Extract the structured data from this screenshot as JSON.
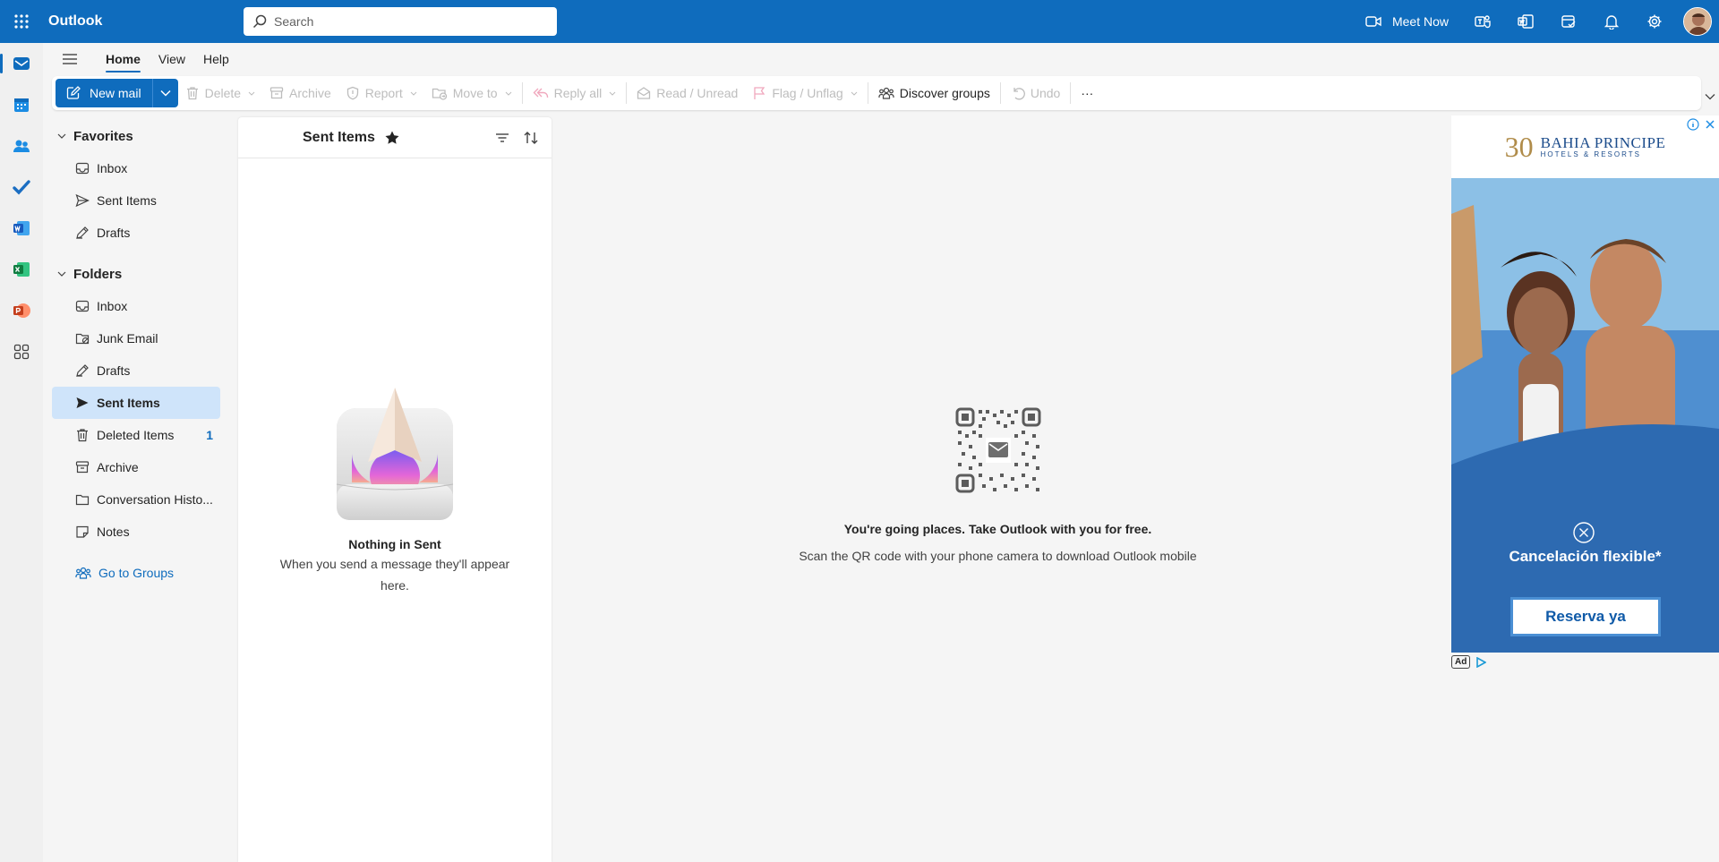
{
  "app": {
    "title": "Outlook"
  },
  "search": {
    "placeholder": "Search"
  },
  "topbar": {
    "meet_now": "Meet Now"
  },
  "tabs": [
    {
      "label": "Home",
      "active": true
    },
    {
      "label": "View",
      "active": false
    },
    {
      "label": "Help",
      "active": false
    }
  ],
  "ribbon": {
    "new_mail": "New mail",
    "delete": "Delete",
    "archive": "Archive",
    "report": "Report",
    "move_to": "Move to",
    "reply_all": "Reply all",
    "read_unread": "Read / Unread",
    "flag_unflag": "Flag / Unflag",
    "discover_groups": "Discover groups",
    "undo": "Undo",
    "more": "···"
  },
  "favorites": {
    "title": "Favorites",
    "items": [
      {
        "label": "Inbox",
        "icon": "inbox-icon"
      },
      {
        "label": "Sent Items",
        "icon": "send-icon"
      },
      {
        "label": "Drafts",
        "icon": "drafts-icon"
      }
    ]
  },
  "folders": {
    "title": "Folders",
    "items": [
      {
        "label": "Inbox",
        "icon": "inbox-icon"
      },
      {
        "label": "Junk Email",
        "icon": "junk-icon"
      },
      {
        "label": "Drafts",
        "icon": "drafts-icon"
      },
      {
        "label": "Sent Items",
        "icon": "send-icon",
        "selected": true
      },
      {
        "label": "Deleted Items",
        "icon": "trash-icon",
        "count": "1"
      },
      {
        "label": "Archive",
        "icon": "archive-icon"
      },
      {
        "label": "Conversation Histo...",
        "icon": "folder-icon"
      },
      {
        "label": "Notes",
        "icon": "notes-icon"
      }
    ],
    "go_to_groups": "Go to Groups"
  },
  "message_list": {
    "title": "Sent Items",
    "empty_title": "Nothing in Sent",
    "empty_text": "When you send a message they'll appear here."
  },
  "reading_pane": {
    "heading": "You're going places. Take Outlook with you for free.",
    "subtext": "Scan the QR code with your phone camera to download Outlook mobile"
  },
  "ad": {
    "logo_number": "30",
    "logo_name": "BAHIA PRINCIPE",
    "logo_sub": "HOTELS & RESORTS",
    "headline": "Cancelación flexible*",
    "cta": "Reserva ya",
    "badge": "Ad"
  },
  "colors": {
    "brand": "#0f6cbd",
    "selected": "#cfe4fa"
  }
}
